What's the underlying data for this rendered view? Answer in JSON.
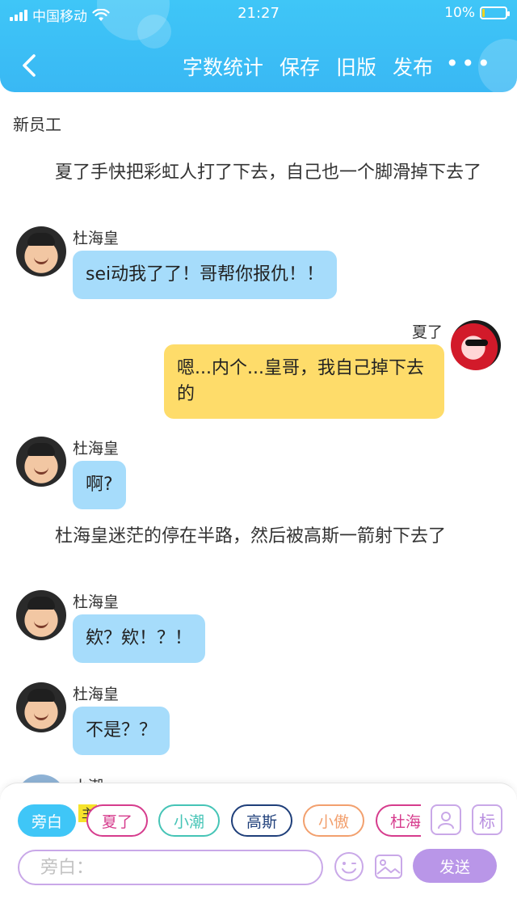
{
  "status_bar": {
    "carrier": "中国移动",
    "time": "21:27",
    "battery": "10%",
    "battery_level": 0.1
  },
  "header": {
    "actions": [
      "字数统计",
      "保存",
      "旧版",
      "发布"
    ],
    "more": "•••",
    "accent": "#3fc6f7"
  },
  "story": {
    "title": "新员工",
    "narration": [
      "夏了手快把彩虹人打了下去，自己也一个脚滑掉下去了",
      "杜海皇迷茫的停在半路，然后被高斯一箭射下去了"
    ],
    "messages": [
      {
        "sender": "杜海皇",
        "text": "sei动我了了！哥帮你报仇！！"
      },
      {
        "sender": "夏了",
        "text": "嗯...内个...皇哥，我自己掉下去的"
      },
      {
        "sender": "杜海皇",
        "text": "啊?"
      },
      {
        "sender": "杜海皇",
        "text": "欸？欸！？！"
      },
      {
        "sender": "杜海皇",
        "text": "不是？？"
      },
      {
        "sender": "小潮",
        "text": ""
      }
    ]
  },
  "bottom": {
    "chips": [
      {
        "label": "旁白",
        "color": "#3fc6f7"
      },
      {
        "label": "夏了",
        "color": "#d63c8d"
      },
      {
        "label": "小潮",
        "color": "#45c4b6"
      },
      {
        "label": "高斯",
        "color": "#1f3f7a"
      },
      {
        "label": "小傲",
        "color": "#f2a06e"
      },
      {
        "label": "杜海",
        "color": "#d63c8d"
      }
    ],
    "main_tag": "主",
    "mark_label": "标",
    "input_placeholder": "旁白：",
    "send_label": "发送"
  }
}
